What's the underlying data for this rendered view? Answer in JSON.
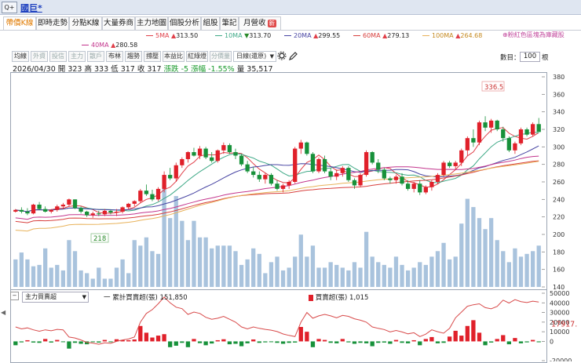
{
  "window": {
    "title": "國巨*",
    "scroll_label": "Q+"
  },
  "tabs": [
    {
      "label": "帶價K線",
      "active": true
    },
    {
      "label": "即時走勢"
    },
    {
      "label": "分點K線"
    },
    {
      "label": "大量券商"
    },
    {
      "label": "主力地圖"
    },
    {
      "label": "個股分析"
    },
    {
      "label": "組股"
    },
    {
      "label": "筆記"
    },
    {
      "label": "月營收",
      "badge": "新"
    }
  ],
  "hint": "⊕粉紅色區塊為庫藏股",
  "ma_legend": [
    {
      "label": "5MA",
      "arrow": "▲",
      "value": "313.50",
      "color": "#e0404a"
    },
    {
      "label": "10MA",
      "arrow": "▼",
      "value": "313.70",
      "color": "#3fa987"
    },
    {
      "label": "20MA",
      "arrow": "▲",
      "value": "299.55",
      "color": "#4845a3"
    },
    {
      "label": "60MA",
      "arrow": "▲",
      "value": "279.13",
      "color": "#d8403e"
    },
    {
      "label": "100MA",
      "arrow": "▲",
      "value": "264.68",
      "color": "#e8b25a"
    },
    {
      "label": "40MA",
      "arrow": "▲",
      "value": "280.58",
      "color": "#c3358d"
    }
  ],
  "toolbar": {
    "buttons": [
      {
        "label": "均線"
      },
      {
        "label": "外資",
        "dim": true
      },
      {
        "label": "投信",
        "dim": true
      },
      {
        "label": "主力",
        "dim": true
      },
      {
        "label": "散戶",
        "dim": true
      },
      {
        "label": "布林"
      },
      {
        "label": "趨勢"
      },
      {
        "label": "撐壓"
      },
      {
        "label": "本益比"
      },
      {
        "label": "紅綠燈"
      },
      {
        "label": "分價量",
        "dim": true
      }
    ],
    "period": "日線(還原)",
    "zoom_label": "數目：",
    "zoom_value": "100",
    "zoom_unit": "根"
  },
  "ohlc": {
    "date": "2026/04/30",
    "open": "開 323",
    "high": "高 333",
    "low": "低 317",
    "close": "收 317",
    "change": "漲跌 -5",
    "pct": "漲幅 -1.55%",
    "volume": "量 35,517"
  },
  "sub": {
    "select": "主力買賣超",
    "cum_label": "一 累計買賣超(張)",
    "cum_value": "151,850",
    "day_label": "買賣超(張)",
    "day_value": "1,015"
  },
  "chart_data": [
    {
      "type": "candlestick",
      "title": "",
      "ylim": [
        140,
        380
      ],
      "y_ticks": [
        140,
        160,
        180,
        200,
        220,
        240,
        260,
        280,
        300,
        320,
        340,
        360,
        380
      ],
      "annotations": {
        "max_label": "336.5",
        "min_label": "218"
      },
      "candles": [
        [
          226,
          229,
          225,
          228
        ],
        [
          228,
          231,
          224,
          226
        ],
        [
          226,
          230,
          222,
          224
        ],
        [
          224,
          235,
          223,
          234
        ],
        [
          234,
          237,
          228,
          229
        ],
        [
          229,
          232,
          225,
          226
        ],
        [
          226,
          229,
          224,
          228
        ],
        [
          228,
          234,
          226,
          232
        ],
        [
          232,
          236,
          229,
          234
        ],
        [
          234,
          241,
          232,
          240
        ],
        [
          240,
          240,
          229,
          230
        ],
        [
          230,
          232,
          224,
          226
        ],
        [
          226,
          227,
          220,
          222
        ],
        [
          222,
          226,
          219,
          224
        ],
        [
          224,
          227,
          221,
          223
        ],
        [
          223,
          229,
          221,
          227
        ],
        [
          227,
          228,
          223,
          225
        ],
        [
          225,
          229,
          221,
          226
        ],
        [
          226,
          232,
          224,
          231
        ],
        [
          231,
          236,
          229,
          235
        ],
        [
          235,
          239,
          232,
          238
        ],
        [
          238,
          252,
          236,
          250
        ],
        [
          250,
          257,
          244,
          246
        ],
        [
          246,
          251,
          238,
          240
        ],
        [
          240,
          254,
          238,
          252
        ],
        [
          252,
          272,
          248,
          268
        ],
        [
          268,
          276,
          262,
          264
        ],
        [
          264,
          282,
          260,
          279
        ],
        [
          279,
          288,
          276,
          286
        ],
        [
          286,
          295,
          282,
          294
        ],
        [
          294,
          299,
          289,
          290
        ],
        [
          290,
          301,
          286,
          298
        ],
        [
          298,
          300,
          286,
          288
        ],
        [
          288,
          294,
          282,
          284
        ],
        [
          284,
          297,
          282,
          296
        ],
        [
          296,
          305,
          292,
          302
        ],
        [
          302,
          304,
          292,
          294
        ],
        [
          294,
          298,
          286,
          290
        ],
        [
          290,
          292,
          278,
          280
        ],
        [
          280,
          284,
          270,
          272
        ],
        [
          272,
          277,
          265,
          268
        ],
        [
          268,
          272,
          260,
          263
        ],
        [
          263,
          270,
          258,
          268
        ],
        [
          268,
          270,
          256,
          258
        ],
        [
          258,
          262,
          250,
          252
        ],
        [
          252,
          258,
          248,
          256
        ],
        [
          256,
          262,
          252,
          260
        ],
        [
          260,
          300,
          258,
          298
        ],
        [
          298,
          308,
          292,
          305
        ],
        [
          305,
          306,
          290,
          292
        ],
        [
          292,
          294,
          270,
          272
        ],
        [
          272,
          288,
          270,
          286
        ],
        [
          286,
          290,
          270,
          272
        ],
        [
          272,
          276,
          262,
          266
        ],
        [
          266,
          274,
          262,
          270
        ],
        [
          270,
          278,
          266,
          276
        ],
        [
          276,
          278,
          260,
          262
        ],
        [
          262,
          264,
          252,
          256
        ],
        [
          256,
          270,
          254,
          268
        ],
        [
          268,
          296,
          266,
          294
        ],
        [
          294,
          295,
          280,
          282
        ],
        [
          282,
          286,
          270,
          274
        ],
        [
          274,
          276,
          262,
          264
        ],
        [
          264,
          266,
          258,
          262
        ],
        [
          262,
          268,
          258,
          266
        ],
        [
          266,
          270,
          256,
          258
        ],
        [
          258,
          262,
          250,
          252
        ],
        [
          252,
          260,
          248,
          258
        ],
        [
          258,
          262,
          245,
          248
        ],
        [
          248,
          256,
          246,
          254
        ],
        [
          254,
          262,
          250,
          260
        ],
        [
          260,
          270,
          258,
          268
        ],
        [
          268,
          284,
          266,
          282
        ],
        [
          282,
          284,
          276,
          278
        ],
        [
          278,
          284,
          274,
          282
        ],
        [
          282,
          298,
          278,
          296
        ],
        [
          296,
          312,
          290,
          310
        ],
        [
          310,
          320,
          300,
          305
        ],
        [
          305,
          330,
          302,
          328
        ],
        [
          328,
          335,
          318,
          322
        ],
        [
          322,
          332,
          316,
          330
        ],
        [
          330,
          331,
          318,
          320
        ],
        [
          320,
          323,
          306,
          310
        ],
        [
          310,
          312,
          294,
          296
        ],
        [
          296,
          306,
          292,
          304
        ],
        [
          304,
          322,
          302,
          320
        ],
        [
          320,
          322,
          312,
          314
        ],
        [
          314,
          328,
          312,
          326
        ],
        [
          326,
          333,
          317,
          317
        ]
      ],
      "volumes": [
        20,
        25,
        20,
        15,
        16,
        28,
        14,
        16,
        12,
        34,
        26,
        12,
        10,
        6,
        14,
        6,
        6,
        14,
        20,
        10,
        34,
        30,
        36,
        26,
        24,
        74,
        50,
        66,
        48,
        34,
        48,
        36,
        36,
        28,
        30,
        30,
        30,
        26,
        16,
        20,
        28,
        24,
        10,
        18,
        22,
        12,
        14,
        22,
        38,
        22,
        30,
        14,
        14,
        18,
        16,
        14,
        12,
        18,
        14,
        40,
        22,
        18,
        16,
        14,
        22,
        16,
        12,
        14,
        18,
        16,
        22,
        26,
        32,
        20,
        22,
        46,
        64,
        58,
        50,
        42,
        50,
        34,
        26,
        18,
        28,
        22,
        24,
        26,
        30
      ],
      "ma_series": [
        {
          "name": "5MA",
          "color": "#e0404a"
        },
        {
          "name": "10MA",
          "color": "#3fa987"
        },
        {
          "name": "20MA",
          "color": "#4845a3"
        },
        {
          "name": "40MA",
          "color": "#c3358d"
        },
        {
          "name": "60MA",
          "color": "#d8403e"
        },
        {
          "name": "100MA",
          "color": "#e8b25a"
        }
      ]
    },
    {
      "type": "bar",
      "title": "",
      "ylim": [
        -20000,
        50000
      ],
      "y_ticks": [
        -20000,
        0,
        10000,
        20000,
        30000,
        40000,
        50000
      ],
      "current_cumulative": "17917.",
      "net_buy_sell": [
        -4000,
        -1000,
        1200,
        -1200,
        -1500,
        2500,
        -1200,
        1500,
        -800,
        -7500,
        -1500,
        -2500,
        -3000,
        -600,
        -1200,
        1500,
        -600,
        2200,
        1500,
        1200,
        2000,
        16000,
        9000,
        4000,
        6000,
        7500,
        -6000,
        -4500,
        -1500,
        -6000,
        2500,
        -1800,
        -4000,
        -2200,
        1200,
        2200,
        -3000,
        -2500,
        -5000,
        -2000,
        2000,
        -1500,
        -1000,
        -800,
        -1500,
        -2500,
        -1500,
        -1200,
        15000,
        10000,
        -6000,
        2500,
        1500,
        -1500,
        -2000,
        2500,
        -1000,
        -2500,
        -1500,
        -2000,
        -5000,
        -1500,
        -1200,
        -2500,
        1500,
        -1500,
        -2000,
        1200,
        -4000,
        2500,
        4500,
        -2000,
        -1500,
        5000,
        11000,
        6000,
        16000,
        22000,
        9000,
        -4000,
        -1200,
        2500,
        6500,
        -3000,
        3500,
        -2000,
        -1000,
        1500,
        -900
      ],
      "cumulative": [
        15000,
        13000,
        14000,
        12000,
        10500,
        12000,
        11000,
        12500,
        12000,
        4500,
        3500,
        1500,
        -1000,
        -1800,
        -3000,
        -1500,
        -2000,
        0,
        1500,
        2500,
        4500,
        20000,
        29000,
        33000,
        39000,
        46000,
        40000,
        35500,
        34000,
        28000,
        30500,
        29000,
        25000,
        23000,
        24000,
        26000,
        23000,
        20000,
        15000,
        13000,
        15000,
        13500,
        12500,
        11700,
        10200,
        7700,
        6200,
        5000,
        20000,
        30000,
        24000,
        26500,
        28000,
        26500,
        24500,
        27000,
        26000,
        23500,
        22000,
        20000,
        15000,
        13500,
        12300,
        9800,
        11300,
        9800,
        7800,
        9000,
        5000,
        7500,
        12000,
        10000,
        8500,
        13500,
        24500,
        30500,
        36500,
        38000,
        39000,
        35000,
        33800,
        36300,
        42800,
        39800,
        43300,
        41300,
        40300,
        41800,
        40900
      ]
    }
  ]
}
